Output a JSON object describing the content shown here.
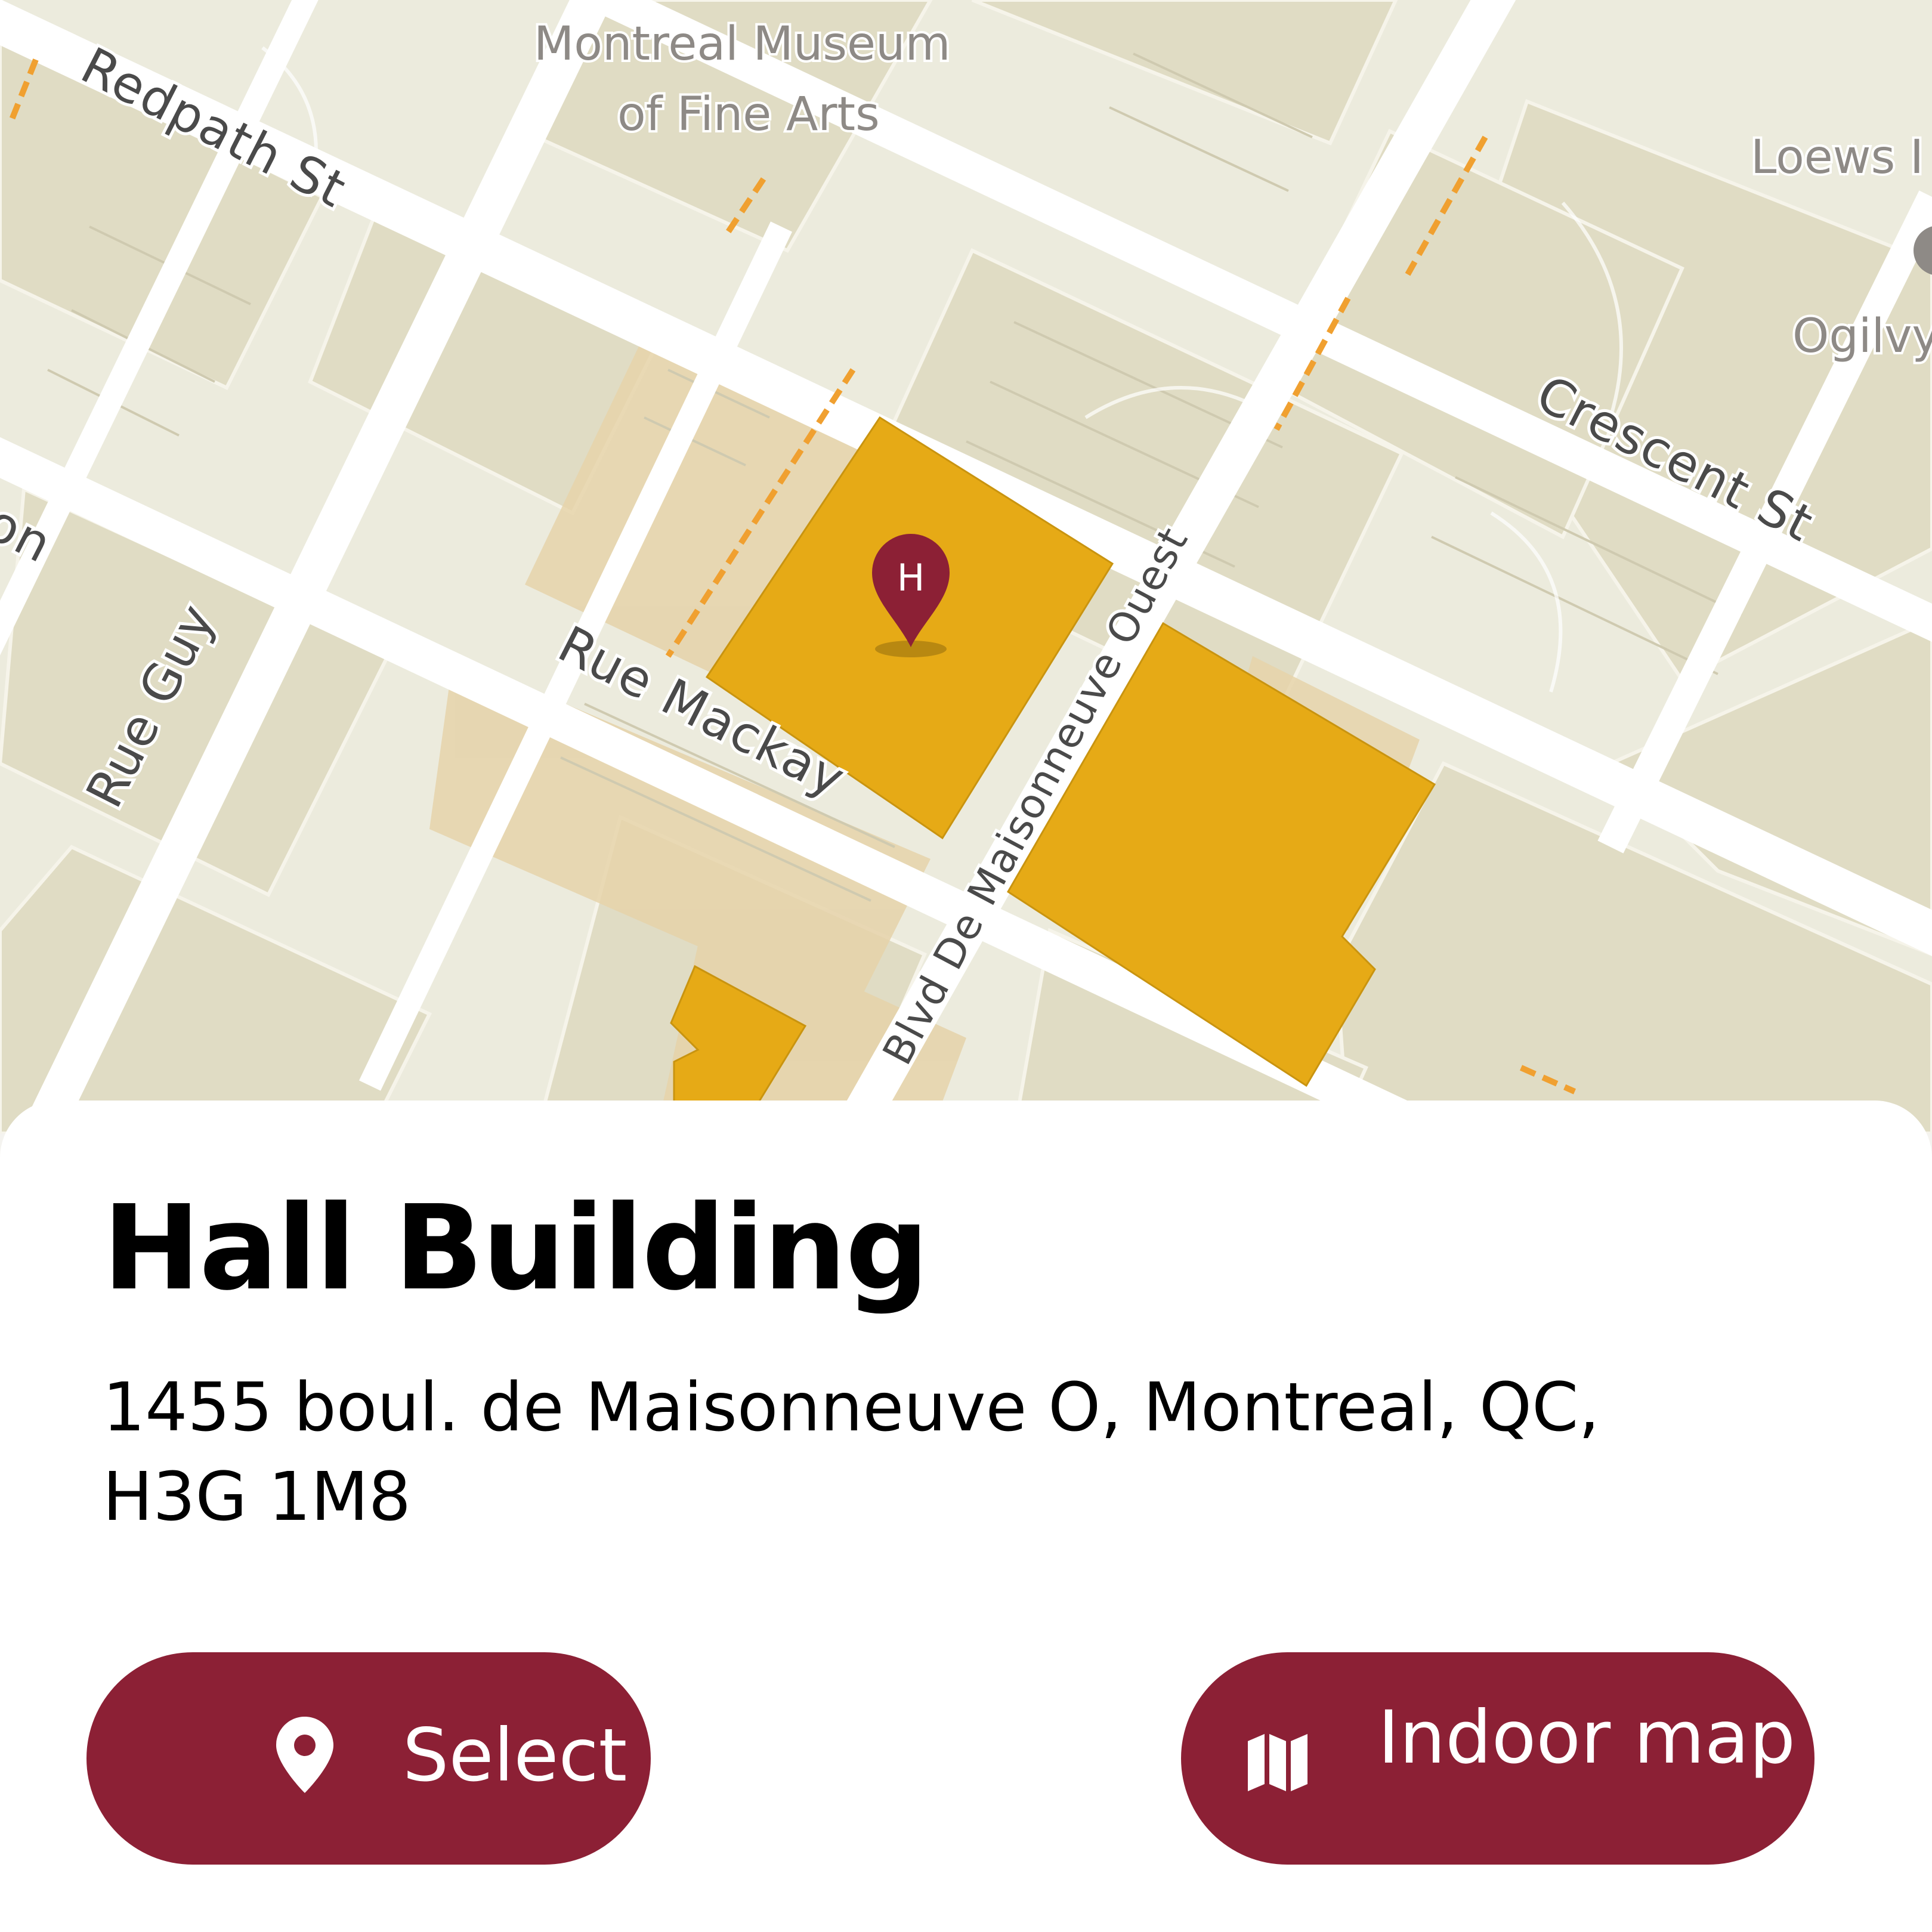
{
  "map": {
    "labels": {
      "museum_line1": "Montreal Museum",
      "museum_line2": "of Fine Arts",
      "redpath": "Redpath St",
      "crescent": "Crescent St",
      "rue_guy": "Rue Guy",
      "rue_mackay": "Rue Mackay",
      "maisonneuve": "Blvd De Maisonneuve Ouest",
      "loews": "Loews I",
      "ogilvy": "Ogilvy",
      "partial_left": "ron"
    },
    "marker_letter": "H",
    "colors": {
      "building_highlight": "#e6aa16",
      "marker": "#8c2035",
      "road": "#ffffff",
      "block": "#e0dcc4"
    }
  },
  "card": {
    "title": "Hall Building",
    "address": "1455 boul. de Maisonneuve O, Montreal, QC, H3G 1M8",
    "buttons": {
      "select_label": "Select",
      "select_icon": "location-pin-icon",
      "indoor_label": "Indoor map",
      "indoor_icon": "folded-map-icon"
    },
    "accent_color": "#8c2035"
  }
}
